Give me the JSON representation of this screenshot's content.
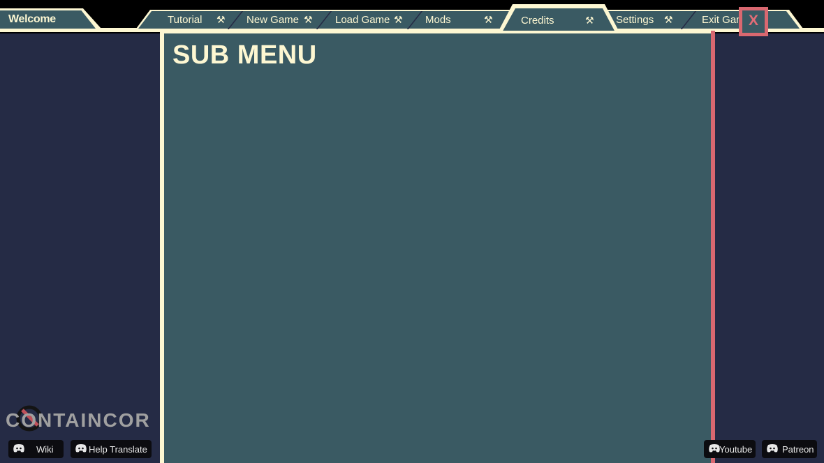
{
  "welcome": {
    "label": "Welcome"
  },
  "tabs": [
    {
      "label": "Tutorial",
      "icon": "hammer-wrench-icon"
    },
    {
      "label": "New Game",
      "icon": "hammer-wrench-icon"
    },
    {
      "label": "Load Game",
      "icon": "hammer-wrench-icon"
    },
    {
      "label": "Mods",
      "icon": "hammer-wrench-icon"
    },
    {
      "label": "Credits",
      "icon": "hammer-wrench-icon",
      "active": true
    },
    {
      "label": "Settings",
      "icon": "hammer-wrench-icon"
    },
    {
      "label": "Exit Game",
      "icon": ""
    }
  ],
  "close_button": {
    "label": "X"
  },
  "panel": {
    "title": "SUB MENU"
  },
  "logo": {
    "text": "CONTAINCOR"
  },
  "links": [
    {
      "label": "Wiki",
      "icon": "discord-icon"
    },
    {
      "label": "Help Translate",
      "icon": "discord-icon"
    },
    {
      "label": "Youtube",
      "icon": "discord-icon"
    },
    {
      "label": "Patreon",
      "icon": "discord-icon"
    }
  ],
  "colors": {
    "background": "#252b45",
    "panel": "#3a5a63",
    "cream": "#fdf7d2",
    "accent_red": "#d96870"
  }
}
